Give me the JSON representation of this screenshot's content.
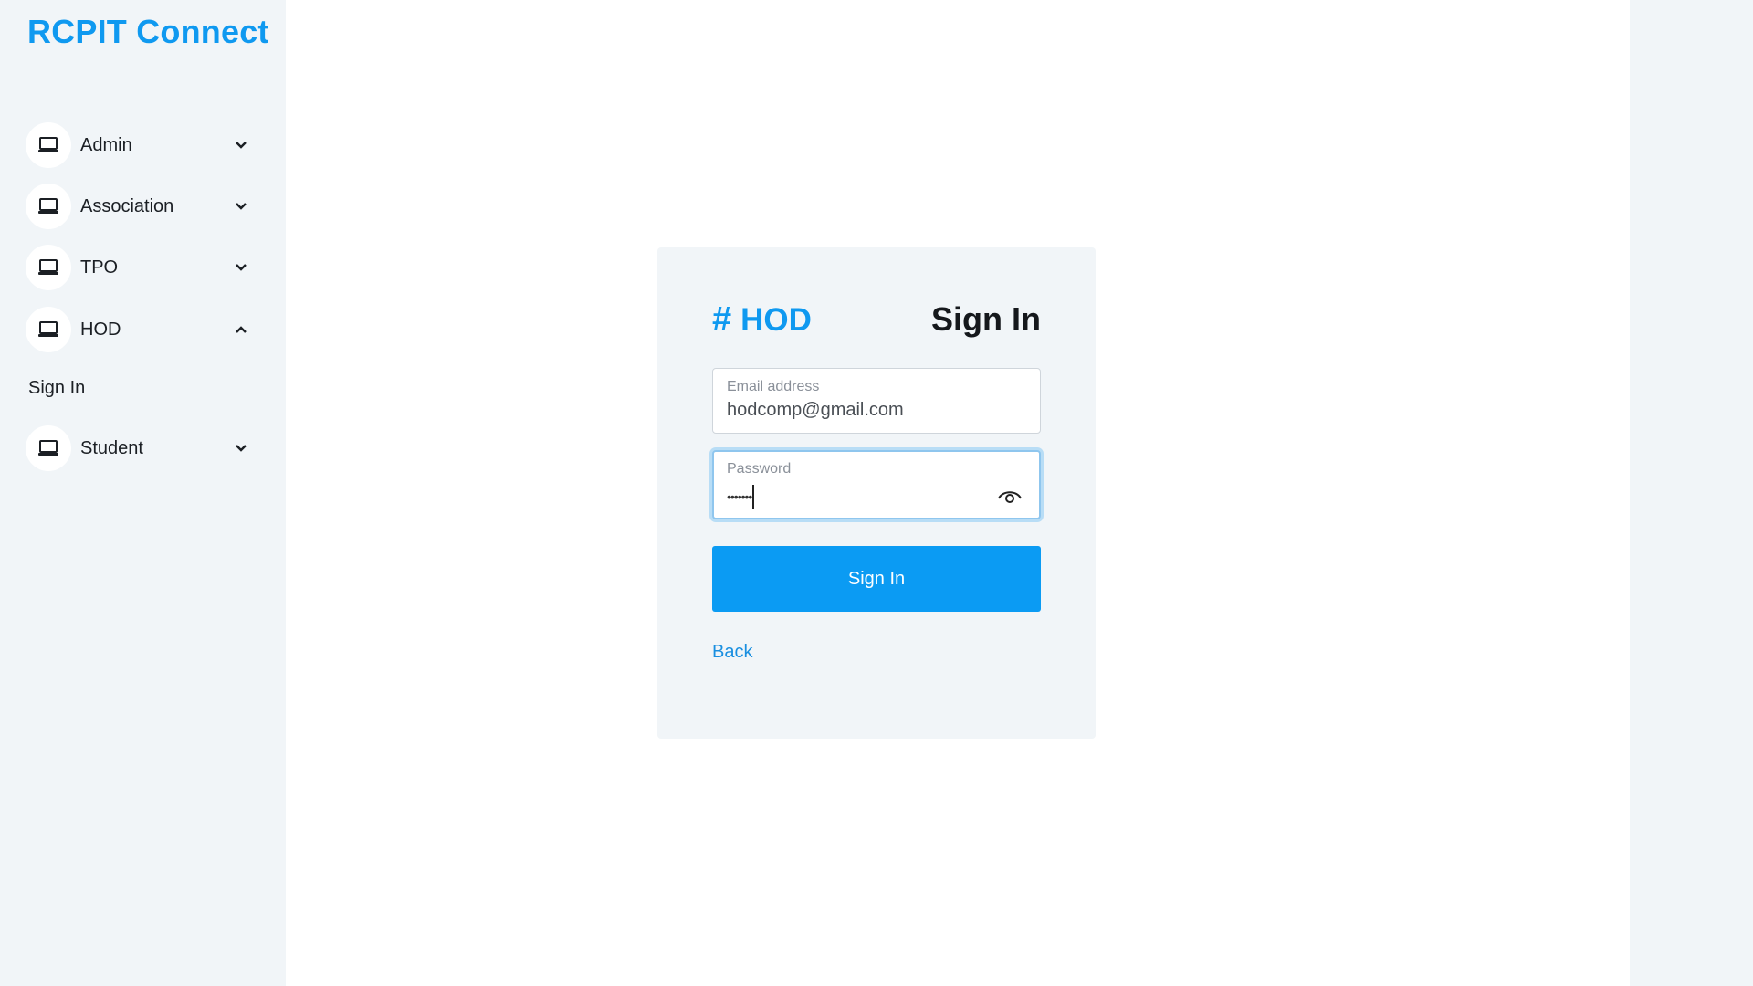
{
  "app": {
    "brand": "RCPIT Connect"
  },
  "sidebar": {
    "items": [
      {
        "label": "Admin",
        "icon": "laptop-icon",
        "expanded": false
      },
      {
        "label": "Association",
        "icon": "laptop-icon",
        "expanded": false
      },
      {
        "label": "TPO",
        "icon": "laptop-icon",
        "expanded": false
      },
      {
        "label": "HOD",
        "icon": "laptop-icon",
        "expanded": true,
        "children": [
          {
            "label": "Sign In"
          }
        ]
      },
      {
        "label": "Student",
        "icon": "laptop-icon",
        "expanded": false
      }
    ]
  },
  "signin": {
    "role": "HOD",
    "role_icon": "hash-icon",
    "heading": "Sign In",
    "email": {
      "label": "Email address",
      "value": "hodcomp@gmail.com"
    },
    "password": {
      "label": "Password",
      "masked_value": "•••••••",
      "toggle_icon": "eye-icon"
    },
    "submit_label": "Sign In",
    "back_label": "Back"
  },
  "colors": {
    "accent": "#0f99f0",
    "button": "#0b9bf3",
    "panel": "#f1f5f8"
  }
}
